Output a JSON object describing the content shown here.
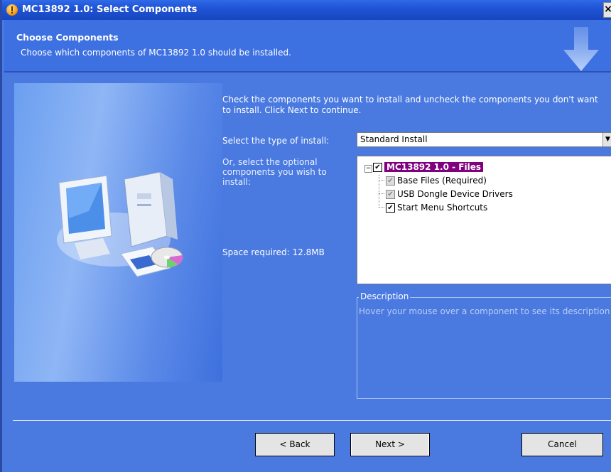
{
  "window": {
    "title": "MC13892 1.0: Select Components",
    "close_glyph": "×"
  },
  "header": {
    "title": "Choose Components",
    "subtitle": "Choose which components of MC13892 1.0 should be installed."
  },
  "body": {
    "instructions": "Check the components you want to install and uncheck the components you don't want to install. Click Next to continue.",
    "install_type_label": "Select the type of install:",
    "install_type_value": "Standard Install",
    "optional_label": "Or, select the optional components you wish to install:",
    "space_required": "Space required: 12.8MB"
  },
  "tree": {
    "root": {
      "label": "MC13892 1.0 - Files",
      "checked": true,
      "expanded": true,
      "expander": "−"
    },
    "items": [
      {
        "label": "Base Files (Required)",
        "checked": true,
        "disabled": true
      },
      {
        "label": "USB Dongle Device Drivers",
        "checked": true,
        "disabled": true
      },
      {
        "label": "Start Menu Shortcuts",
        "checked": true,
        "disabled": false
      }
    ],
    "check_glyph": "✔"
  },
  "description": {
    "legend": "Description",
    "text": "Hover your mouse over a component to see its description"
  },
  "buttons": {
    "back": "< Back",
    "next": "Next >",
    "cancel": "Cancel"
  },
  "icons": [
    "installer-icon",
    "close-icon",
    "down-arrow-icon",
    "computer-cd-icon",
    "dropdown-arrow-icon",
    "checkbox-icon"
  ],
  "colors": {
    "background": "#4a7ae0",
    "titlebar": "#1f54d6",
    "selection": "#800080"
  }
}
